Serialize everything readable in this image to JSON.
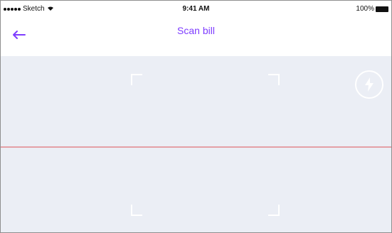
{
  "status_bar": {
    "carrier": "Sketch",
    "time": "9:41 AM",
    "battery": "100%",
    "wifi_icon": "wifi-icon",
    "battery_icon": "battery-icon"
  },
  "nav": {
    "title": "Scan bill",
    "back_icon": "arrow-left-icon",
    "accent_color": "#7e3cff"
  },
  "scanner": {
    "background_color": "#ebeef5",
    "scan_line_color": "#e4a0a6",
    "flash_icon": "lightning-icon"
  }
}
